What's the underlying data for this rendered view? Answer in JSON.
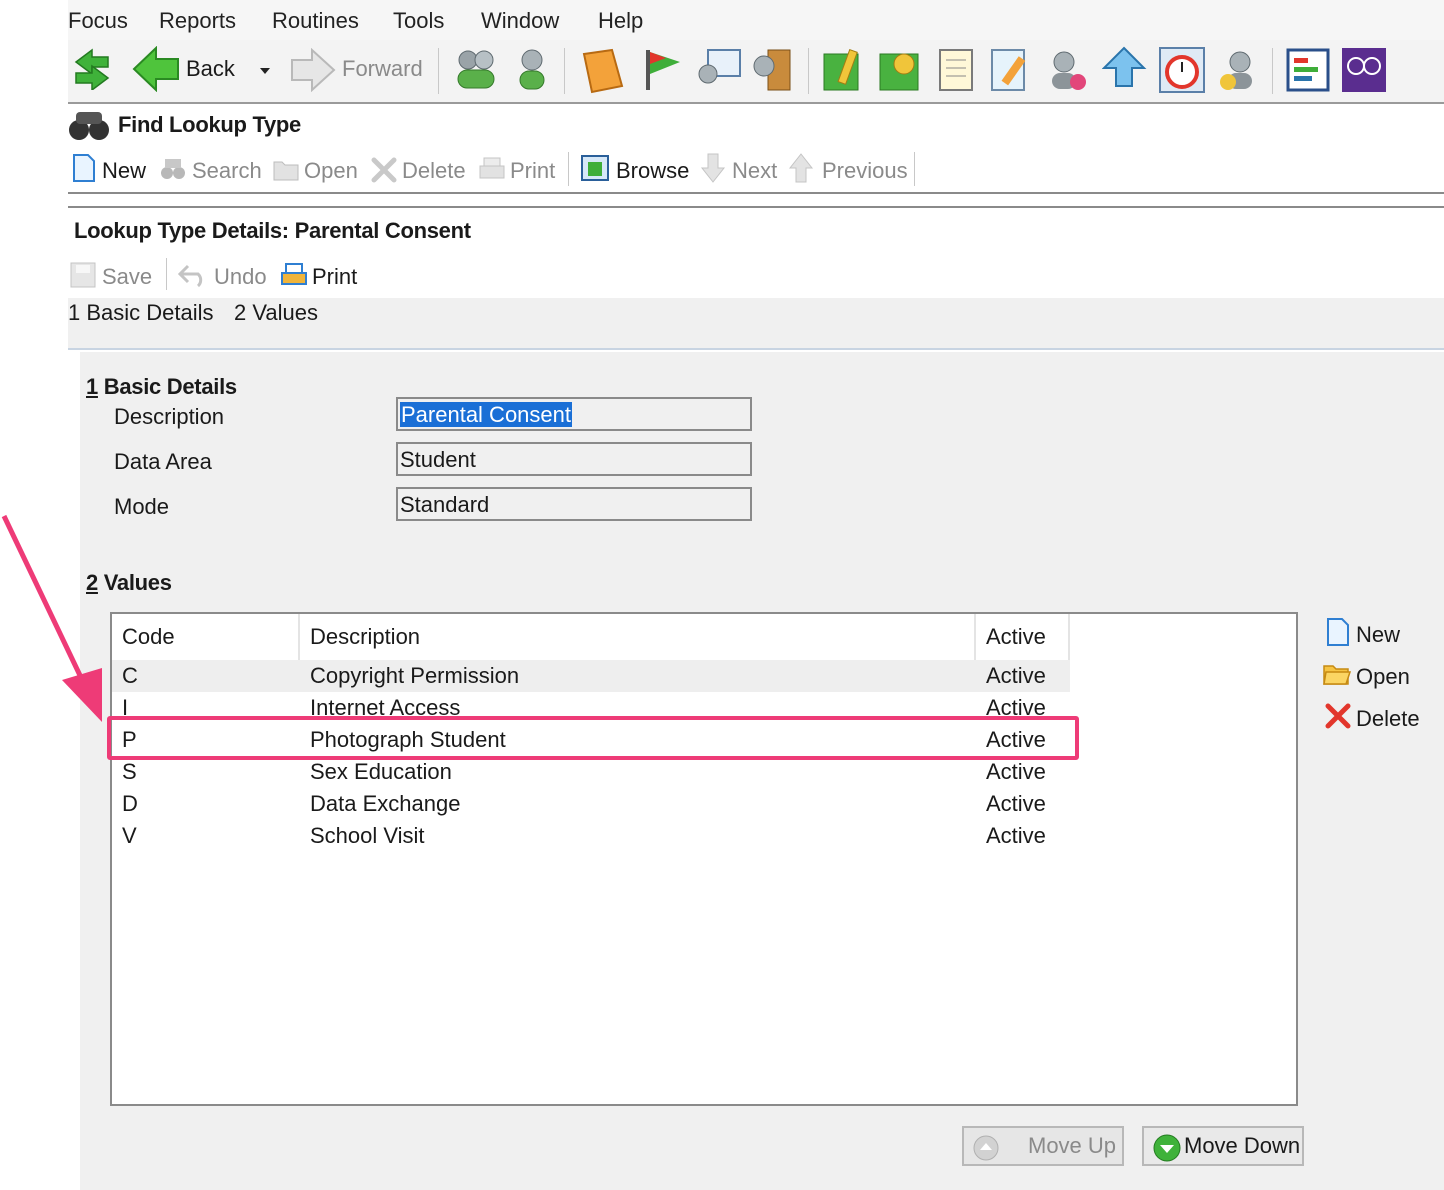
{
  "menu": [
    "Focus",
    "Reports",
    "Routines",
    "Tools",
    "Window",
    "Help"
  ],
  "menu_mnemonics": [
    "F",
    "R",
    "R",
    "T",
    "W",
    "H"
  ],
  "nav": {
    "back": "Back",
    "forward": "Forward"
  },
  "find_panel": {
    "title": "Find Lookup Type",
    "buttons": {
      "new": "New",
      "search": "Search",
      "open": "Open",
      "delete": "Delete",
      "print": "Print",
      "browse": "Browse",
      "next": "Next",
      "previous": "Previous"
    }
  },
  "details": {
    "title": "Lookup Type Details: Parental Consent",
    "buttons": {
      "save": "Save",
      "undo": "Undo",
      "print": "Print"
    },
    "tabs": [
      "1 Basic Details",
      "2 Values"
    ]
  },
  "basic": {
    "section_num": "1",
    "section_title": " Basic Details",
    "fields": [
      {
        "label": "Description",
        "value": "Parental Consent"
      },
      {
        "label": "Data Area",
        "value": "Student"
      },
      {
        "label": "Mode",
        "value": "Standard"
      }
    ]
  },
  "values": {
    "section_num": "2",
    "section_title": " Values",
    "columns": [
      "Code",
      "Description",
      "Active"
    ],
    "rows": [
      {
        "code": "C",
        "description": "Copyright Permission",
        "active": "Active"
      },
      {
        "code": "I",
        "description": "Internet Access",
        "active": "Active"
      },
      {
        "code": "P",
        "description": "Photograph Student",
        "active": "Active"
      },
      {
        "code": "S",
        "description": "Sex Education",
        "active": "Active"
      },
      {
        "code": "D",
        "description": "Data Exchange",
        "active": "Active"
      },
      {
        "code": "V",
        "description": "School Visit",
        "active": "Active"
      }
    ],
    "side_buttons": {
      "new": "New",
      "open": "Open",
      "delete": "Delete"
    },
    "move_up": "Move Up",
    "move_down": "Move Down"
  },
  "colors": {
    "highlight": "#ee3b77",
    "selection": "#1a6fd6"
  }
}
